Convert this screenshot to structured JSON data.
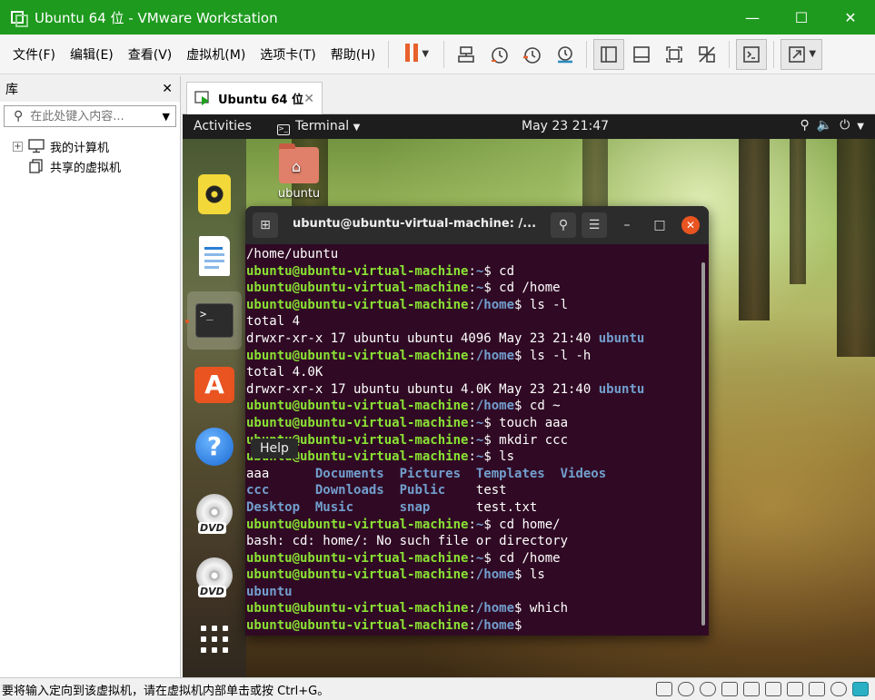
{
  "window": {
    "title": "Ubuntu 64 位 - VMware Workstation"
  },
  "menu": [
    "文件(F)",
    "编辑(E)",
    "查看(V)",
    "虚拟机(M)",
    "选项卡(T)",
    "帮助(H)"
  ],
  "library": {
    "title": "库",
    "search_placeholder": "在此处键入内容...",
    "tree": [
      "我的计算机",
      "共享的虚拟机"
    ]
  },
  "tab": {
    "label": "Ubuntu 64 位"
  },
  "gnome": {
    "activities": "Activities",
    "app": "Terminal",
    "clock": "May 23  21:47"
  },
  "desktop": {
    "home_label": "ubuntu"
  },
  "dock": {
    "help_tooltip": "Help",
    "dvd_label": "DVD"
  },
  "terminal": {
    "title": "ubuntu@ubuntu-virtual-machine: /...",
    "lines": [
      [
        {
          "t": "/home/ubuntu",
          "c": ""
        }
      ],
      [
        {
          "t": "ubuntu@ubuntu-virtual-machine",
          "c": "pu"
        },
        {
          "t": ":",
          "c": ""
        },
        {
          "t": "~",
          "c": "pp"
        },
        {
          "t": "$ cd",
          "c": ""
        }
      ],
      [
        {
          "t": "ubuntu@ubuntu-virtual-machine",
          "c": "pu"
        },
        {
          "t": ":",
          "c": ""
        },
        {
          "t": "~",
          "c": "pp"
        },
        {
          "t": "$ cd /home",
          "c": ""
        }
      ],
      [
        {
          "t": "ubuntu@ubuntu-virtual-machine",
          "c": "pu"
        },
        {
          "t": ":",
          "c": ""
        },
        {
          "t": "/home",
          "c": "pp"
        },
        {
          "t": "$ ls -l",
          "c": ""
        }
      ],
      [
        {
          "t": "total 4",
          "c": ""
        }
      ],
      [
        {
          "t": "drwxr-xr-x 17 ubuntu ubuntu 4096 May 23 21:40 ",
          "c": ""
        },
        {
          "t": "ubuntu",
          "c": "bl"
        }
      ],
      [
        {
          "t": "ubuntu@ubuntu-virtual-machine",
          "c": "pu"
        },
        {
          "t": ":",
          "c": ""
        },
        {
          "t": "/home",
          "c": "pp"
        },
        {
          "t": "$ ls -l -h",
          "c": ""
        }
      ],
      [
        {
          "t": "total 4.0K",
          "c": ""
        }
      ],
      [
        {
          "t": "drwxr-xr-x 17 ubuntu ubuntu 4.0K May 23 21:40 ",
          "c": ""
        },
        {
          "t": "ubuntu",
          "c": "bl"
        }
      ],
      [
        {
          "t": "ubuntu@ubuntu-virtual-machine",
          "c": "pu"
        },
        {
          "t": ":",
          "c": ""
        },
        {
          "t": "/home",
          "c": "pp"
        },
        {
          "t": "$ cd ~",
          "c": ""
        }
      ],
      [
        {
          "t": "ubuntu@ubuntu-virtual-machine",
          "c": "pu"
        },
        {
          "t": ":",
          "c": ""
        },
        {
          "t": "~",
          "c": "pp"
        },
        {
          "t": "$ touch aaa",
          "c": ""
        }
      ],
      [
        {
          "t": "ubuntu@ubuntu-virtual-machine",
          "c": "pu"
        },
        {
          "t": ":",
          "c": ""
        },
        {
          "t": "~",
          "c": "pp"
        },
        {
          "t": "$ mkdir ccc",
          "c": ""
        }
      ],
      [
        {
          "t": "ubuntu@ubuntu-virtual-machine",
          "c": "pu"
        },
        {
          "t": ":",
          "c": ""
        },
        {
          "t": "~",
          "c": "pp"
        },
        {
          "t": "$ ls",
          "c": ""
        }
      ],
      [
        {
          "t": "aaa      ",
          "c": ""
        },
        {
          "t": "Documents",
          "c": "bl"
        },
        {
          "t": "  ",
          "c": ""
        },
        {
          "t": "Pictures",
          "c": "bl"
        },
        {
          "t": "  ",
          "c": ""
        },
        {
          "t": "Templates",
          "c": "bl"
        },
        {
          "t": "  ",
          "c": ""
        },
        {
          "t": "Videos",
          "c": "bl"
        }
      ],
      [
        {
          "t": "ccc",
          "c": "bl"
        },
        {
          "t": "      ",
          "c": ""
        },
        {
          "t": "Downloads",
          "c": "bl"
        },
        {
          "t": "  ",
          "c": ""
        },
        {
          "t": "Public",
          "c": "bl"
        },
        {
          "t": "    test",
          "c": ""
        }
      ],
      [
        {
          "t": "Desktop",
          "c": "bl"
        },
        {
          "t": "  ",
          "c": ""
        },
        {
          "t": "Music",
          "c": "bl"
        },
        {
          "t": "      ",
          "c": ""
        },
        {
          "t": "snap",
          "c": "bl"
        },
        {
          "t": "      test.txt",
          "c": ""
        }
      ],
      [
        {
          "t": "ubuntu@ubuntu-virtual-machine",
          "c": "pu"
        },
        {
          "t": ":",
          "c": ""
        },
        {
          "t": "~",
          "c": "pp"
        },
        {
          "t": "$ cd home/",
          "c": ""
        }
      ],
      [
        {
          "t": "bash: cd: home/: No such file or directory",
          "c": ""
        }
      ],
      [
        {
          "t": "ubuntu@ubuntu-virtual-machine",
          "c": "pu"
        },
        {
          "t": ":",
          "c": ""
        },
        {
          "t": "~",
          "c": "pp"
        },
        {
          "t": "$ cd /home",
          "c": ""
        }
      ],
      [
        {
          "t": "ubuntu@ubuntu-virtual-machine",
          "c": "pu"
        },
        {
          "t": ":",
          "c": ""
        },
        {
          "t": "/home",
          "c": "pp"
        },
        {
          "t": "$ ls",
          "c": ""
        }
      ],
      [
        {
          "t": "ubuntu",
          "c": "bl"
        }
      ],
      [
        {
          "t": "ubuntu@ubuntu-virtual-machine",
          "c": "pu"
        },
        {
          "t": ":",
          "c": ""
        },
        {
          "t": "/home",
          "c": "pp"
        },
        {
          "t": "$ which",
          "c": ""
        }
      ],
      [
        {
          "t": "ubuntu@ubuntu-virtual-machine",
          "c": "pu"
        },
        {
          "t": ":",
          "c": ""
        },
        {
          "t": "/home",
          "c": "pp"
        },
        {
          "t": "$ ",
          "c": ""
        }
      ]
    ]
  },
  "status": {
    "message": "要将输入定向到该虚拟机，请在虚拟机内部单击或按 Ctrl+G。"
  },
  "colors": {
    "titlebar": "#1e9a1e",
    "terminal_bg": "#300a24",
    "prompt_user": "#8ae234",
    "prompt_path": "#729fcf",
    "ubuntu_orange": "#e95420"
  }
}
